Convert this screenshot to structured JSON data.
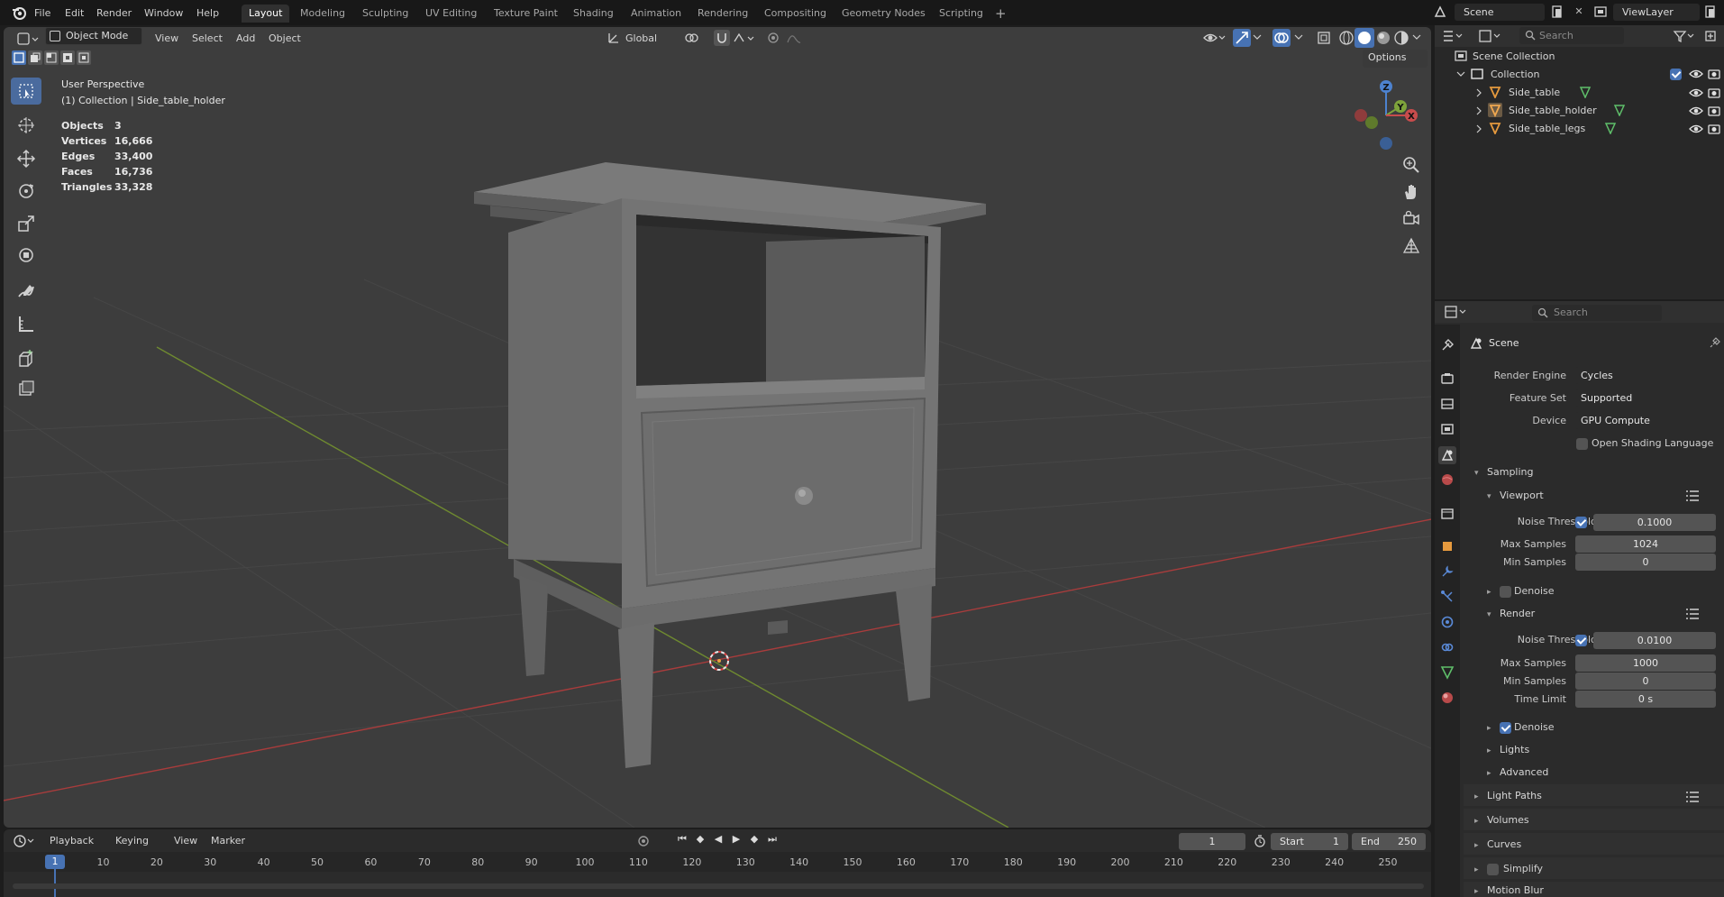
{
  "menus": [
    "File",
    "Edit",
    "Render",
    "Window",
    "Help"
  ],
  "workspaces": [
    "Layout",
    "Modeling",
    "Sculpting",
    "UV Editing",
    "Texture Paint",
    "Shading",
    "Animation",
    "Rendering",
    "Compositing",
    "Geometry Nodes",
    "Scripting"
  ],
  "active_workspace": "Layout",
  "top_right": {
    "scene": "Scene",
    "view_layer": "ViewLayer"
  },
  "viewport_header": {
    "mode": "Object Mode",
    "menus": [
      "View",
      "Select",
      "Add",
      "Object"
    ],
    "transform_orientation": "Global",
    "options_label": "Options"
  },
  "viewport": {
    "perspective": "User Perspective",
    "collection_info": "(1) Collection | Side_table_holder",
    "stats": [
      {
        "label": "Objects",
        "value": "3"
      },
      {
        "label": "Vertices",
        "value": "16,666"
      },
      {
        "label": "Edges",
        "value": "33,400"
      },
      {
        "label": "Faces",
        "value": "16,736"
      },
      {
        "label": "Triangles",
        "value": "33,328"
      }
    ],
    "gizmo_axes": [
      "Z",
      "Y",
      "X"
    ]
  },
  "outliner": {
    "search_placeholder": "Search",
    "scene_collection": "Scene Collection",
    "collection": "Collection",
    "objects": [
      "Side_table",
      "Side_table_holder",
      "Side_table_legs"
    ]
  },
  "properties": {
    "search_placeholder": "Search",
    "context": "Scene",
    "render_engine_label": "Render Engine",
    "render_engine": "Cycles",
    "feature_set_label": "Feature Set",
    "feature_set": "Supported",
    "device_label": "Device",
    "device": "GPU Compute",
    "osl_label": "Open Shading Language",
    "sampling": "Sampling",
    "viewport": "Viewport",
    "noise_threshold_label": "Noise Threshold",
    "max_samples_label": "Max Samples",
    "min_samples_label": "Min Samples",
    "time_limit_label": "Time Limit",
    "vp_noise_threshold": "0.1000",
    "vp_max_samples": "1024",
    "vp_min_samples": "0",
    "denoise": "Denoise",
    "render": "Render",
    "r_noise_threshold": "0.0100",
    "r_max_samples": "1000",
    "r_min_samples": "0",
    "r_time_limit": "0 s",
    "lights": "Lights",
    "advanced": "Advanced",
    "light_paths": "Light Paths",
    "volumes": "Volumes",
    "curves": "Curves",
    "simplify": "Simplify",
    "motion_blur": "Motion Blur"
  },
  "timeline": {
    "menus": [
      "Playback",
      "Keying",
      "View",
      "Marker"
    ],
    "current_frame": "1",
    "start_label": "Start",
    "start": "1",
    "end_label": "End",
    "end": "250",
    "ticks": [
      "1",
      "10",
      "20",
      "30",
      "40",
      "50",
      "60",
      "70",
      "80",
      "90",
      "100",
      "110",
      "120",
      "130",
      "140",
      "150",
      "160",
      "170",
      "180",
      "190",
      "200",
      "210",
      "220",
      "230",
      "240",
      "250"
    ]
  },
  "colors": {
    "accent": "#4772b3",
    "x_axis": "#c84c4c",
    "y_axis": "#7ea33b",
    "z_axis": "#4d82cf",
    "active_frame": "#4772b3"
  }
}
